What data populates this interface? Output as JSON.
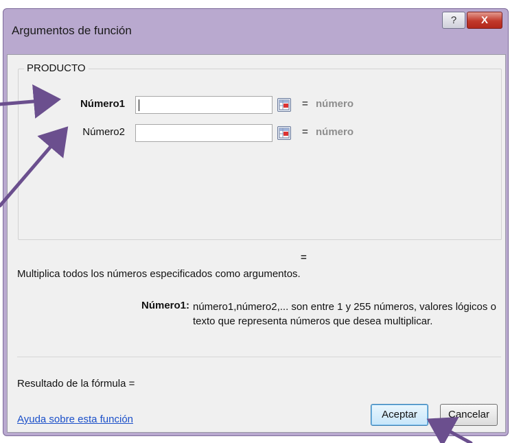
{
  "dialog": {
    "title": "Argumentos de función",
    "help_glyph": "?",
    "close_glyph": "X"
  },
  "function_name": "PRODUCTO",
  "arguments": [
    {
      "label": "Número1",
      "value": "",
      "equals": "=",
      "type_hint": "número"
    },
    {
      "label": "Número2",
      "value": "",
      "equals": "=",
      "type_hint": "número"
    }
  ],
  "result_equals": "=",
  "description": "Multiplica todos los números especificados como argumentos.",
  "arg_help": {
    "label": "Número1:",
    "text": "número1,número2,... son entre 1 y 255 números, valores lógicos o texto que representa números que desea multiplicar."
  },
  "formula_result": "Resultado de la fórmula =",
  "help_link": "Ayuda sobre esta función",
  "buttons": {
    "ok": "Aceptar",
    "cancel": "Cancelar"
  },
  "colors": {
    "frame": "#b9a9cf",
    "annotation_arrow": "#6b4f8e",
    "link": "#1a4fc9"
  },
  "icons": [
    "help-icon",
    "close-icon",
    "range-selector-icon",
    "annotation-arrow"
  ]
}
